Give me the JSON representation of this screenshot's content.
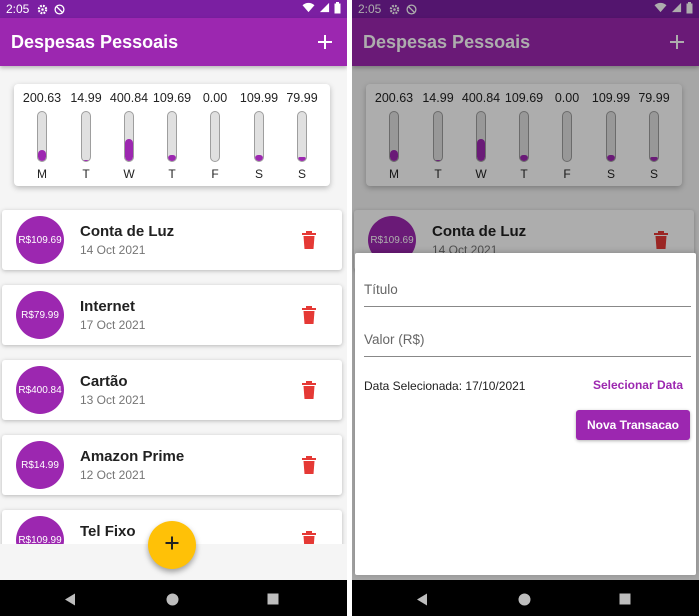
{
  "status_bar": {
    "time": "2:05"
  },
  "app_bar": {
    "title": "Despesas Pessoais"
  },
  "chart_data": {
    "type": "bar",
    "categories": [
      "M",
      "T",
      "W",
      "T",
      "F",
      "S",
      "S"
    ],
    "values": [
      200.63,
      14.99,
      400.84,
      109.69,
      0.0,
      109.99,
      79.99
    ],
    "value_labels": [
      "200.63",
      "14.99",
      "400.84",
      "109.69",
      "0.00",
      "109.99",
      "79.99"
    ],
    "fractions": [
      0.23,
      0.02,
      0.45,
      0.13,
      0.0,
      0.13,
      0.09
    ]
  },
  "transactions": [
    {
      "amount": "R$109.69",
      "title": "Conta de Luz",
      "date": "14 Oct 2021"
    },
    {
      "amount": "R$79.99",
      "title": "Internet",
      "date": "17 Oct 2021"
    },
    {
      "amount": "R$400.84",
      "title": "Cartão",
      "date": "13 Oct 2021"
    },
    {
      "amount": "R$14.99",
      "title": "Amazon Prime",
      "date": "12 Oct 2021"
    },
    {
      "amount": "R$109.99",
      "title": "Tel Fixo",
      "date": ""
    }
  ],
  "form": {
    "title_placeholder": "Título",
    "value_placeholder": "Valor (R$)",
    "selected_date": "Data Selecionada: 17/10/2021",
    "select_date_label": "Selecionar Data",
    "submit_label": "Nova Transacao"
  },
  "colors": {
    "primary": "#9c27b0",
    "primary_dark": "#7b1fa2",
    "accent": "#ffc107",
    "delete": "#e53935"
  },
  "icons": {
    "app_add": "plus-icon",
    "delete": "trash-icon",
    "fab": "plus-icon",
    "nav_back": "triangle-back-icon",
    "nav_home": "circle-home-icon",
    "nav_recents": "square-recents-icon"
  }
}
